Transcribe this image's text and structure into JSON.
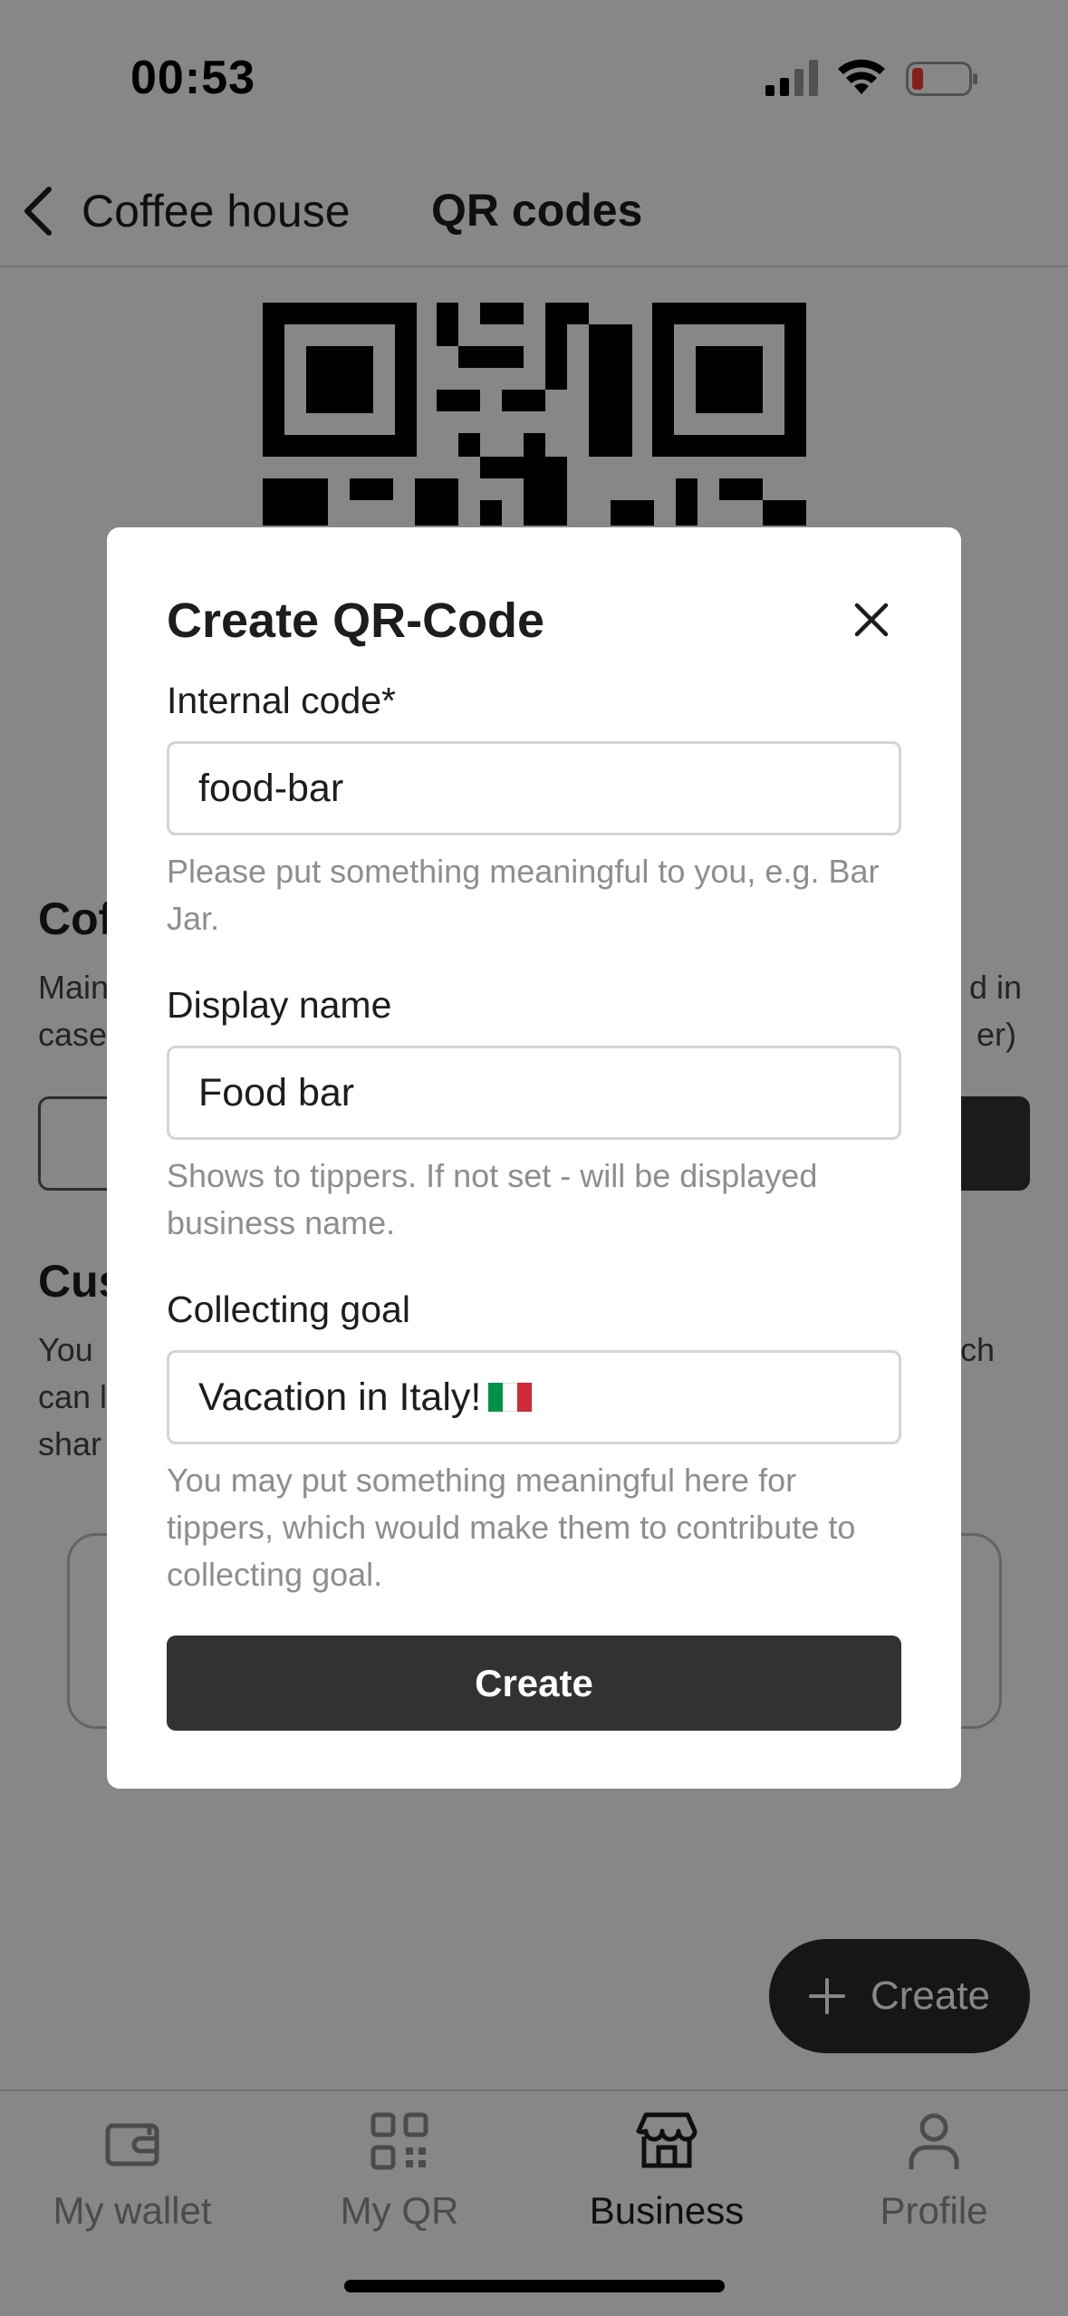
{
  "status_bar": {
    "time": "00:53"
  },
  "header": {
    "back_label": "Coffee house",
    "title": "QR codes"
  },
  "background": {
    "section1_title": "Cof",
    "section1_text_line1": "Main",
    "section1_text_line2": "case",
    "section1_text_right1": "d in",
    "section1_text_right2": "er)",
    "section2_title": "Cus",
    "section2_text_line1": "You",
    "section2_text_line2": "can l",
    "section2_text_line3": "shar",
    "section2_text_right1": "ch"
  },
  "modal": {
    "title": "Create QR-Code",
    "fields": [
      {
        "label": "Internal code*",
        "value": "food-bar",
        "help": "Please put something meaningful to you, e.g. Bar Jar."
      },
      {
        "label": "Display name",
        "value": "Food bar",
        "help": "Shows to tippers. If not set - will be displayed business name."
      },
      {
        "label": "Collecting goal",
        "value": "Vacation in Italy!",
        "help": "You may put something meaningful here for tippers, which would make them to contribute to collecting goal."
      }
    ],
    "submit_label": "Create"
  },
  "fab": {
    "label": "Create"
  },
  "tabs": [
    {
      "label": "My wallet",
      "icon": "wallet-icon",
      "active": false
    },
    {
      "label": "My QR",
      "icon": "qr-icon",
      "active": false
    },
    {
      "label": "Business",
      "icon": "store-icon",
      "active": true
    },
    {
      "label": "Profile",
      "icon": "person-icon",
      "active": false
    }
  ],
  "colors": {
    "flag_green": "#009246",
    "flag_white": "#ffffff",
    "flag_red": "#ce2b37",
    "battery_low": "#ff3b30",
    "button_dark": "#323232"
  }
}
